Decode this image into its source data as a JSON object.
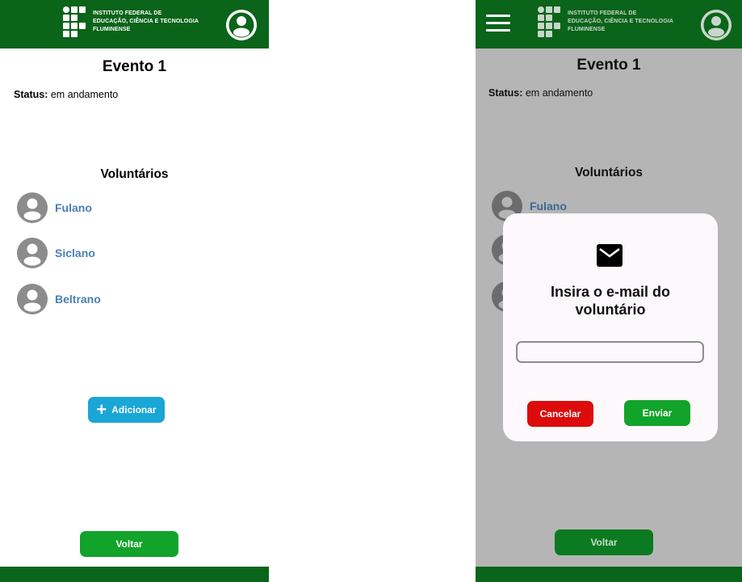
{
  "brand": {
    "line1": "INSTITUTO FEDERAL DE",
    "line2": "EDUCAÇÃO, CIÊNCIA E TECNOLOGIA",
    "line3": "FLUMINENSE"
  },
  "colors": {
    "header_green": "#0a6419",
    "action_green": "#11a32a",
    "add_blue": "#1aa6d6",
    "cancel_red": "#dd0b0b",
    "name_blue": "#4a80b8",
    "overlay_gray": "#b5b5b5"
  },
  "icons": {
    "profile": "account-circle-icon",
    "menu": "hamburger-menu-icon",
    "mail": "mail-icon",
    "add": "plus-icon",
    "volunteer_avatar": "person-avatar-icon"
  },
  "event": {
    "title": "Evento 1",
    "status_label": "Status:",
    "status_value": "em andamento"
  },
  "volunteers": {
    "heading": "Voluntários",
    "items": [
      {
        "name": "Fulano"
      },
      {
        "name": "Siclano"
      },
      {
        "name": "Beltrano"
      }
    ]
  },
  "actions": {
    "add_label": "Adicionar",
    "back_label": "Voltar"
  },
  "modal": {
    "title": "Insira o e-mail do voluntário",
    "email_value": "",
    "cancel_label": "Cancelar",
    "send_label": "Enviar"
  }
}
